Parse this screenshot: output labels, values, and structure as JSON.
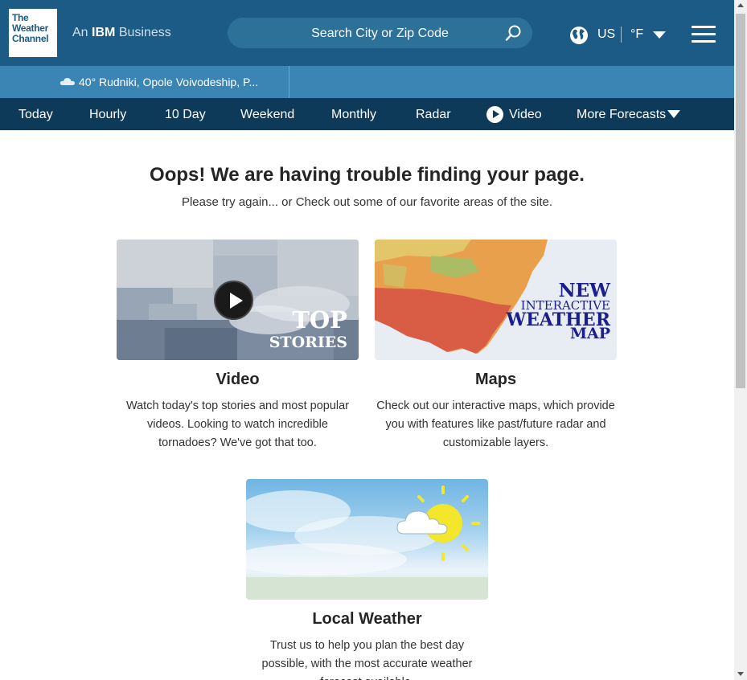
{
  "header": {
    "logo_lines": [
      "The",
      "Weather",
      "Channel"
    ],
    "tagline_prefix": "An",
    "tagline_brand": "IBM",
    "tagline_suffix": "Business",
    "search_placeholder": "Search City or Zip Code",
    "locale": "US",
    "unit": "°F",
    "icons": {
      "search": "search-icon",
      "globe": "globe-icon",
      "caret": "caret-down-icon",
      "menu": "hamburger-menu-icon"
    }
  },
  "recent_location": {
    "temp": "40°",
    "name": "Rudniki, Opole Voivodeship, P...",
    "condition_icon": "cloud-icon"
  },
  "nav": {
    "items": [
      "Today",
      "Hourly",
      "10 Day",
      "Weekend",
      "Monthly",
      "Radar",
      "Video",
      "More Forecasts"
    ]
  },
  "error": {
    "title": "Oops! We are having trouble finding your page.",
    "subtitle": "Please try again... or Check out some of our favorite areas of the site."
  },
  "cards": [
    {
      "title": "Video",
      "description": "Watch today's top stories and most popular videos. Looking to watch incredible tornadoes? We've got that too.",
      "image_text_1": "TOP",
      "image_text_2": "STORIES"
    },
    {
      "title": "Maps",
      "description": "Check out our interactive maps, which provide you with features like past/future radar and customizable layers.",
      "image_text_1": "NEW",
      "image_text_2": "INTERACTIVE",
      "image_text_3": "WEATHER",
      "image_text_4": "MAP"
    },
    {
      "title": "Local Weather",
      "description": "Trust us to help you plan the best day possible, with the most accurate weather forecast available."
    }
  ],
  "colors": {
    "header": "#1b5b86",
    "strip": "#3a85b3",
    "nav": "#0d3a59"
  }
}
